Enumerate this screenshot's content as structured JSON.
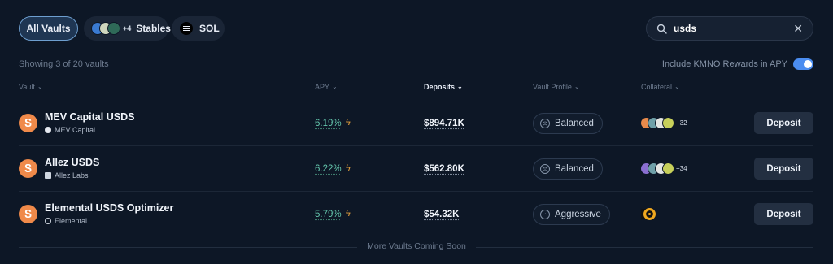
{
  "filters": {
    "all_label": "All Vaults",
    "stables_count": "+4",
    "stables_label": "Stables",
    "sol_label": "SOL"
  },
  "search": {
    "value": "usds",
    "placeholder": ""
  },
  "showing_text": "Showing 3 of 20 vaults",
  "kmno_label": "Include KMNO Rewards in APY",
  "kmno_enabled": true,
  "columns": {
    "vault": "Vault",
    "apy": "APY",
    "deposits": "Deposits",
    "profile": "Vault Profile",
    "collateral": "Collateral"
  },
  "vaults": [
    {
      "name": "MEV Capital USDS",
      "curator": "MEV Capital",
      "apy": "6.19%",
      "deposits": "$894.71K",
      "profile": "Balanced",
      "collateral_more": "+32",
      "action": "Deposit"
    },
    {
      "name": "Allez USDS",
      "curator": "Allez Labs",
      "apy": "6.22%",
      "deposits": "$562.80K",
      "profile": "Balanced",
      "collateral_more": "+34",
      "action": "Deposit"
    },
    {
      "name": "Elemental USDS Optimizer",
      "curator": "Elemental",
      "apy": "5.79%",
      "deposits": "$54.32K",
      "profile": "Aggressive",
      "collateral_more": "",
      "action": "Deposit"
    }
  ],
  "footer": "More Vaults Coming Soon",
  "colors": {
    "accent": "#4b8df0",
    "apy": "#63c4ab",
    "vault_icon": "#f08a4a",
    "bolt": "#e7a23c"
  },
  "icons": {
    "search": "search-icon",
    "clear": "close-icon",
    "chevron": "chevron-down-icon",
    "apy_boost": "lightning-icon",
    "vault": "usds-token-icon"
  }
}
